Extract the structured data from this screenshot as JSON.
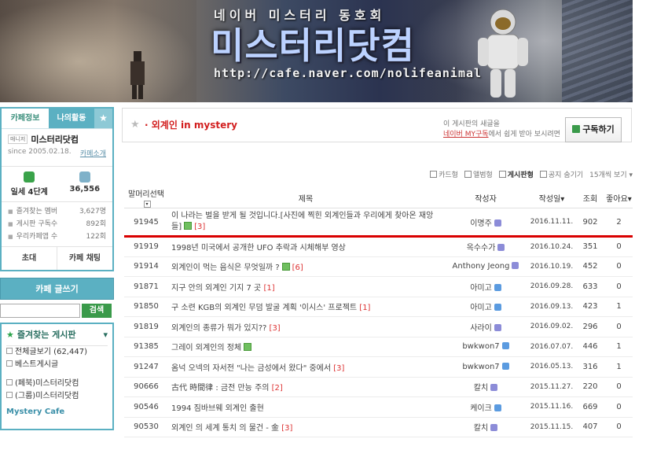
{
  "banner": {
    "subtitle": "네이버 미스터리 동호회",
    "title": "미스터리닷컴",
    "url": "http://cafe.naver.com/nolifeanimal"
  },
  "sidebar": {
    "tabs": [
      "카페정보",
      "나의활동"
    ],
    "cafe_tag": "매니저",
    "cafe_name": "미스터리닷컴",
    "since": "since 2005.02.18.",
    "intro_link": "카페소개",
    "level": "일세 4단계",
    "members": "36,556",
    "stats": [
      {
        "label": "즐겨찾는 멤버",
        "value": "3,627명"
      },
      {
        "label": "게시판 구독수",
        "value": "892회"
      },
      {
        "label": "우리카페앱 수",
        "value": "122회"
      }
    ],
    "invite_label": "초대",
    "chat_label": "카페 채팅",
    "write_label": "카페 글쓰기",
    "search_value": "",
    "search_btn": "검색",
    "fav_header": "즐겨찾는 게시판",
    "fav_items": [
      "전체글보기 (62,447)",
      "베스트게시글"
    ],
    "fav_items2": [
      "(페북)미스터리닷컴",
      "(그룹)미스터리닷컴"
    ],
    "mystery_cafe": "Mystery Cafe"
  },
  "board": {
    "title": "외계인 in mystery",
    "notice_line1": "이 게시판의 새글을",
    "notice_link": "네이버 MY구독",
    "notice_line2": "에서 쉽게 받아 보시려면",
    "subscribe": "구독하기"
  },
  "viewbar": {
    "card": "카드형",
    "album": "앨범형",
    "list": "게시판형",
    "hide_notice": "공지 숨기기",
    "per_page": "15개씩 보기"
  },
  "table": {
    "headers": [
      "말머리선택",
      "제목",
      "작성자",
      "작성일",
      "조회",
      "좋아요"
    ],
    "rows": [
      {
        "no": "91945",
        "title": "이 나라는 벌을 받게 될 것입니다.[사진에 찍힌 외계인들과 우리에게 찾아온 재앙들]",
        "new": true,
        "comments": "[3]",
        "author": "이명주",
        "date": "2016.11.11.",
        "views": "902",
        "likes": "2"
      },
      {
        "no": "91919",
        "title": "1998년 미국에서 공개한 UFO 추락과 시체해부 영상",
        "new": false,
        "comments": "",
        "author": "옥수수가",
        "date": "2016.10.24.",
        "views": "351",
        "likes": "0"
      },
      {
        "no": "91914",
        "title": "외계인이 먹는 음식은 무엇일까 ?",
        "new": true,
        "comments": "[6]",
        "author": "Anthony Jeong",
        "date": "2016.10.19.",
        "views": "452",
        "likes": "0"
      },
      {
        "no": "91871",
        "title": "지구 안의 외계인 기지 7 곳",
        "new": false,
        "comments": "[1]",
        "author": "아미고",
        "date": "2016.09.28.",
        "views": "633",
        "likes": "0"
      },
      {
        "no": "91850",
        "title": "구 소련 KGB의 외계인 무덤 발굴 계획 '이시스' 프로젝트",
        "new": false,
        "comments": "[1]",
        "author": "아미고",
        "date": "2016.09.13.",
        "views": "423",
        "likes": "1"
      },
      {
        "no": "91819",
        "title": "외계인의 종류가 뭐가 있지??",
        "new": false,
        "comments": "[3]",
        "author": "사라이",
        "date": "2016.09.02.",
        "views": "296",
        "likes": "0"
      },
      {
        "no": "91385",
        "title": "그레이 외계인의 정체",
        "new": true,
        "comments": "",
        "author": "bwkwon7",
        "date": "2016.07.07.",
        "views": "446",
        "likes": "1"
      },
      {
        "no": "91247",
        "title": "옴넉 오넥의 자서전 \"나는 금성에서 왔다\" 중에서",
        "new": false,
        "comments": "[3]",
        "author": "bwkwon7",
        "date": "2016.05.13.",
        "views": "316",
        "likes": "1"
      },
      {
        "no": "90666",
        "title": "古代 時間律 : 금전 만능 주의",
        "new": false,
        "comments": "[2]",
        "author": "칼치",
        "date": "2015.11.27.",
        "views": "220",
        "likes": "0"
      },
      {
        "no": "90546",
        "title": "1994 짐바브웨 외계인 출현",
        "new": false,
        "comments": "",
        "author": "케이크",
        "date": "2015.11.16.",
        "views": "669",
        "likes": "0"
      },
      {
        "no": "90530",
        "title": "외계인 의 세계 통치 의 물건 - 金",
        "new": false,
        "comments": "[3]",
        "author": "칼치",
        "date": "2015.11.15.",
        "views": "407",
        "likes": "0"
      }
    ]
  }
}
